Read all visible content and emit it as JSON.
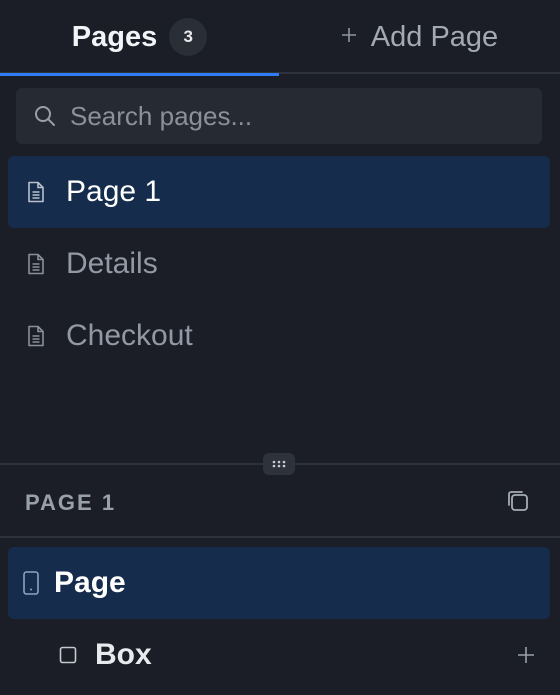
{
  "tabs": {
    "pages": {
      "label": "Pages",
      "count": "3"
    },
    "add_page": {
      "label": "Add Page",
      "icon": "plus-icon"
    }
  },
  "search": {
    "placeholder": "Search pages...",
    "value": ""
  },
  "pages": [
    {
      "label": "Page 1",
      "icon": "document-icon",
      "active": true
    },
    {
      "label": "Details",
      "icon": "document-icon",
      "active": false
    },
    {
      "label": "Checkout",
      "icon": "document-icon",
      "active": false
    }
  ],
  "section": {
    "title": "PAGE 1",
    "copy_icon": "copy-icon"
  },
  "layers": [
    {
      "label": "Page",
      "icon": "phone-icon",
      "active": true
    },
    {
      "label": "Box",
      "icon": "square-icon",
      "active": false,
      "action_icon": "plus-icon"
    }
  ],
  "colors": {
    "background": "#1b1e26",
    "accent": "#2f7df6",
    "selected_row": "#152c4c",
    "search_bg": "#262a33"
  }
}
